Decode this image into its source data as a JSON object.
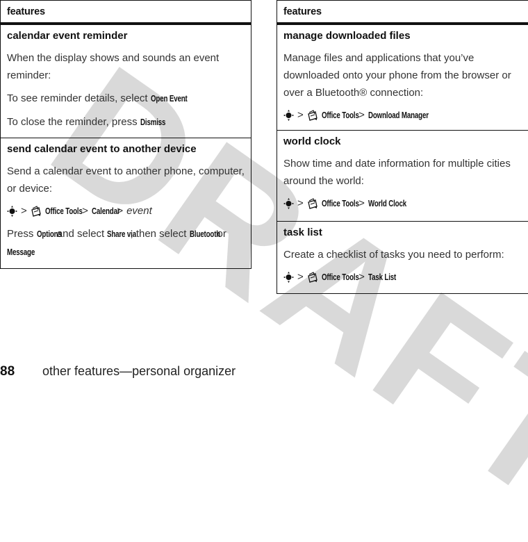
{
  "watermark": "DRAFT",
  "left_table": {
    "header": "features",
    "rows": [
      {
        "title": "calendar event reminder",
        "intro": "When the display shows and sounds an event reminder:",
        "line1_pre": "To see reminder details, select ",
        "line1_key": "Open Event",
        "line1_post": ".",
        "line2_pre": "To close the reminder, press ",
        "line2_key": "Dismiss",
        "line2_post": "."
      },
      {
        "title": "send calendar event to another device",
        "intro": "Send a calendar event to another phone, computer, or device:",
        "nav": {
          "nav_icon": "nav-key-icon",
          "sep": ">",
          "tools_icon": "office-tools-icon",
          "path": [
            "Office Tools",
            "Calendar"
          ],
          "last": "event"
        },
        "press_pre": "Press ",
        "press_key1": "Options",
        "press_mid1": " and select ",
        "press_key2": "Share via",
        "press_mid2": ", then select ",
        "press_key3": "Bluetooth",
        "press_mid3": " or ",
        "press_key4": "Message",
        "press_post": "."
      }
    ]
  },
  "right_table": {
    "header": "features",
    "rows": [
      {
        "title": "manage downloaded files",
        "intro": "Manage files and applications that you’ve downloaded onto your phone from the browser or over a Bluetooth® connection:",
        "nav": {
          "sep": ">",
          "path": [
            "Office Tools",
            "Download Manager"
          ]
        }
      },
      {
        "title": "world clock",
        "intro": "Show time and date information for multiple cities around the world:",
        "nav": {
          "sep": ">",
          "path": [
            "Office Tools",
            "World Clock"
          ]
        }
      },
      {
        "title": "task list",
        "intro": "Create a checklist of tasks you need to perform:",
        "nav": {
          "sep": ">",
          "path": [
            "Office Tools",
            "Task List"
          ]
        }
      }
    ]
  },
  "footer": {
    "page_number": "88",
    "section_title": "other features—personal organizer"
  }
}
